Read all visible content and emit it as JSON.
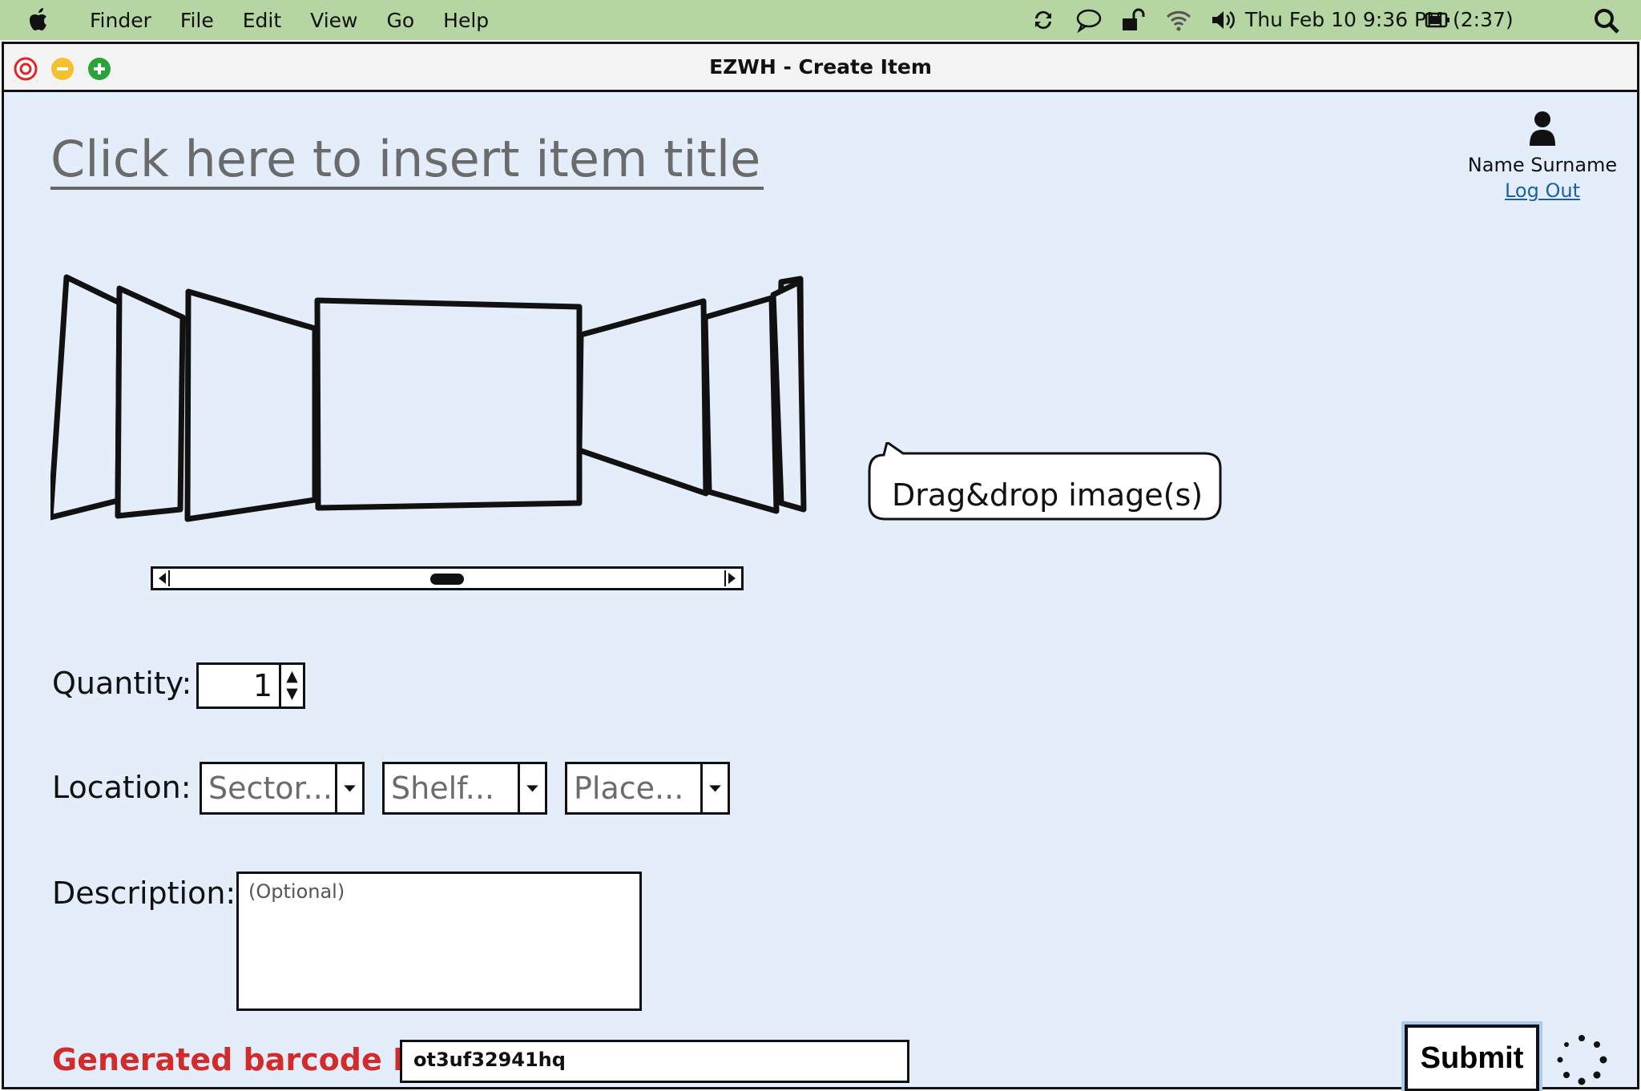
{
  "menubar": {
    "items": [
      "Finder",
      "File",
      "Edit",
      "View",
      "Go",
      "Help"
    ],
    "clock": "Thu Feb 10  9:36 PM",
    "battery": "(2:37)",
    "icons": [
      "apple-icon",
      "sync-icon",
      "chat-bubble-icon",
      "unlock-icon",
      "wifi-icon",
      "volume-icon",
      "battery-icon",
      "search-icon"
    ]
  },
  "window": {
    "title": "EZWH - Create Item",
    "traffic_lights": {
      "close": "#e0262b",
      "minimize": "#f2c12e",
      "maximize": "#2aa33b"
    }
  },
  "page": {
    "title_placeholder": "Click here to insert item title...",
    "user": {
      "name": "Name Surname",
      "logout": "Log Out"
    },
    "dragdrop_hint": "Drag&drop image(s)",
    "quantity": {
      "label": "Quantity:",
      "value": "1"
    },
    "location": {
      "label": "Location:",
      "sector": "Sector...",
      "shelf": "Shelf...",
      "place": "Place..."
    },
    "description": {
      "label": "Description:",
      "placeholder": "(Optional)"
    },
    "barcode": {
      "label": "Generated barcode ID:",
      "value": "ot3uf32941hq"
    },
    "submit_label": "Submit"
  },
  "colors": {
    "background": "#e3eefa",
    "menubar": "#b5d5a3",
    "barcode_label": "#d12b2b",
    "link": "#1a5fa8",
    "submit_focus": "#a9c9ee"
  }
}
